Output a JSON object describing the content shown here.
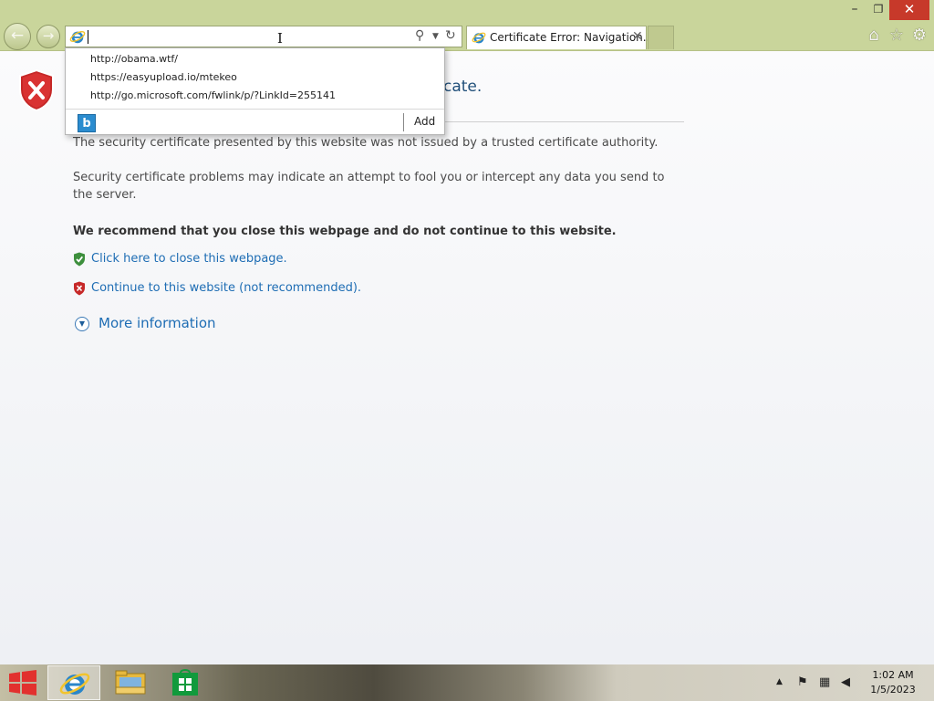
{
  "window": {
    "minimize": "–",
    "maximize": "❐",
    "close": "✕"
  },
  "nav": {
    "back": "←",
    "forward": "→"
  },
  "address_bar": {
    "value": "",
    "icons": [
      "ie-icon",
      "search-icon",
      "dropdown-icon",
      "refresh-icon"
    ]
  },
  "tab": {
    "title": "Certificate Error: Navigation...",
    "close": "✕"
  },
  "toolbar_icons": [
    "home-icon",
    "favorites-icon",
    "gear-icon"
  ],
  "suggestions": {
    "items": [
      "http://obama.wtf/",
      "https://easyupload.io/mtekeo",
      "http://go.microsoft.com/fwlink/p/?LinkId=255141"
    ],
    "bing_label": "b",
    "add_label": "Add"
  },
  "page": {
    "title_visible": "cate.",
    "para1": "The security certificate presented by this website was not issued by a trusted certificate authority.",
    "para2": "Security certificate problems may indicate an attempt to fool you or intercept any data you send to the server.",
    "recommend": "We recommend that you close this webpage and do not continue to this website.",
    "close_link": "Click here to close this webpage.",
    "continue_link": "Continue to this website (not recommended).",
    "more_info": "More information"
  },
  "taskbar": {
    "apps": [
      "internet-explorer",
      "file-explorer",
      "store"
    ],
    "clock_time": "1:02 AM",
    "clock_date": "1/5/2023"
  },
  "colors": {
    "frame": "#c9d59b",
    "link": "#1e6db4",
    "title": "#1f4e79",
    "close_button": "#c7392a"
  }
}
